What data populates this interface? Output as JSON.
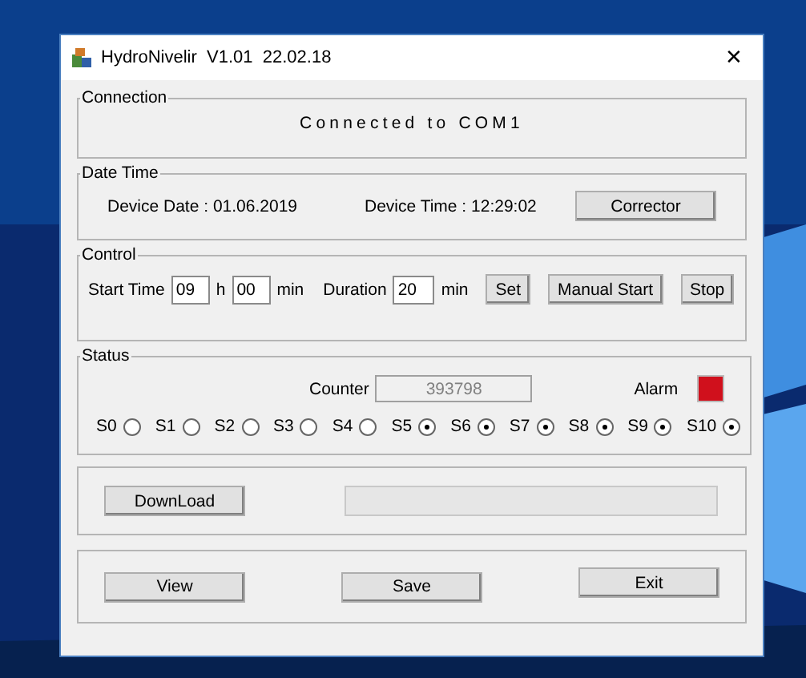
{
  "window": {
    "title": "HydroNivelir  V1.01  22.02.18",
    "close": "✕"
  },
  "connection": {
    "title": "Connection",
    "status": "Connected to COM1"
  },
  "date_time": {
    "title": "Date Time",
    "device_date": "Device Date : 01.06.2019",
    "device_time": "Device Time : 12:29:02",
    "button": "Corrector"
  },
  "control": {
    "title": "Control",
    "start_label": "Start Time",
    "hour": "09",
    "hour_unit": "h",
    "minute": "00",
    "minute_unit": "min",
    "duration_label": "Duration",
    "duration": "20",
    "duration_unit": "min",
    "buttons": [
      "Set",
      "Manual Start",
      "Stop"
    ]
  },
  "status": {
    "title": "Status",
    "counter_label": "Counter",
    "counter": "393798",
    "alarm_label": "Alarm",
    "alarm_on": true,
    "sensors": [
      {
        "label": "S0",
        "checked": false
      },
      {
        "label": "S1",
        "checked": false
      },
      {
        "label": "S2",
        "checked": false
      },
      {
        "label": "S3",
        "checked": false
      },
      {
        "label": "S4",
        "checked": false
      },
      {
        "label": "S5",
        "checked": true
      },
      {
        "label": "S6",
        "checked": true
      },
      {
        "label": "S7",
        "checked": true
      },
      {
        "label": "S8",
        "checked": true
      },
      {
        "label": "S9",
        "checked": true
      },
      {
        "label": "S10",
        "checked": true
      }
    ]
  },
  "download": {
    "button": "DownLoad",
    "level": 0
  },
  "footer": {
    "buttons": [
      "View",
      "Save",
      "Exit"
    ]
  }
}
